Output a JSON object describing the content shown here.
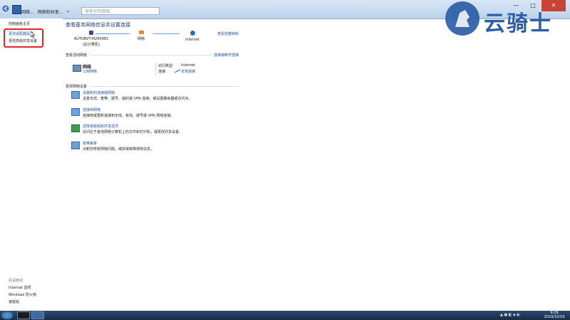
{
  "titlebar": {
    "breadcrumb": [
      "网络...",
      "网络和共享...",
      "»"
    ],
    "search_placeholder": "搜索控制面板"
  },
  "watermark": {
    "text": "云骑士"
  },
  "sidebar": {
    "home": "控制面板主页",
    "links": [
      "更改适配器设置",
      "更改高级共享设置"
    ],
    "see_also": "另请参阅",
    "see_also_items": [
      "Internet 选项",
      "Windows 防火墙",
      "家庭组"
    ]
  },
  "main": {
    "title": "查看基本网络信息并设置连接",
    "map": {
      "nodes": [
        {
          "label": "AUTOBVT-M284982",
          "sub": "(此计算机)"
        },
        {
          "label": "网络",
          "sub": ""
        },
        {
          "label": "Internet",
          "sub": ""
        }
      ],
      "full_map_link": "查看完整映射"
    },
    "active_networks": {
      "label": "查看活动网络",
      "link": "连接或断开连接",
      "network_name": "网络",
      "network_type": "公用网络",
      "access_type_label": "访问类型:",
      "access_type_value": "Internet",
      "connections_label": "连接:",
      "connections_value": "本地连接"
    },
    "change_settings": {
      "label": "更改网络设置",
      "tasks": [
        {
          "link": "设置新的连接或网络",
          "desc": "设置无线、宽带、拨号、临时或 VPN 连接；或设置路由器或访问点。",
          "icon": "network-setup-icon"
        },
        {
          "link": "连接到网络",
          "desc": "连接到或重新连接到无线、有线、拨号或 VPN 网络连接。",
          "icon": "connect-network-icon"
        },
        {
          "link": "选择家庭组和共享选项",
          "desc": "访问位于其他网络计算机上的文件和打印机，或更改共享设置。",
          "icon": "homegroup-icon"
        },
        {
          "link": "疑难解答",
          "desc": "诊断并修复网络问题，或获得故障排除信息。",
          "icon": "troubleshoot-icon"
        }
      ]
    }
  },
  "taskbar": {
    "time": "9:29",
    "date": "2019/10/19"
  },
  "colors": {
    "link": "#1d55a8",
    "highlight_box": "#e32626",
    "taskbar": "#1f3553"
  }
}
